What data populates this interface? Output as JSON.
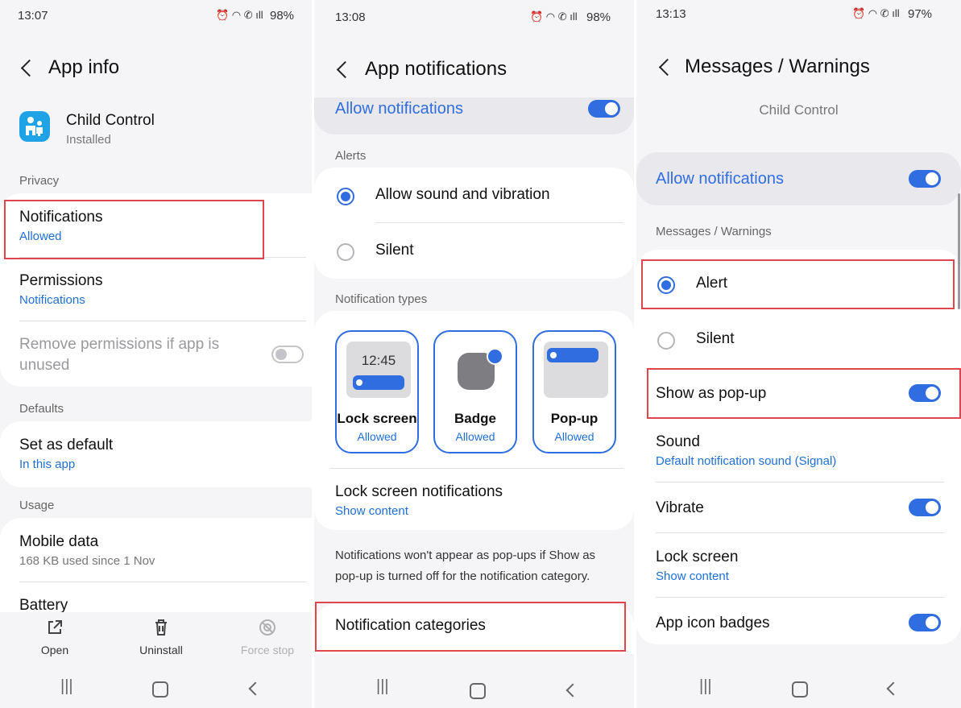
{
  "status": {
    "p1": {
      "time": "13:07",
      "battery": "98%"
    },
    "p2": {
      "time": "13:08",
      "battery": "98%"
    },
    "p3": {
      "time": "13:13",
      "battery": "97%"
    }
  },
  "panel1": {
    "title": "App info",
    "app_name": "Child Control",
    "app_status": "Installed",
    "section_privacy": "Privacy",
    "notifications": {
      "label": "Notifications",
      "value": "Allowed"
    },
    "permissions": {
      "label": "Permissions",
      "value": "Notifications"
    },
    "remove_permissions": {
      "label_line1": "Remove permissions if app is",
      "label_line2": "unused",
      "enabled": false
    },
    "section_defaults": "Defaults",
    "set_default": {
      "label": "Set as default",
      "value": "In this app"
    },
    "section_usage": "Usage",
    "mobile_data": {
      "label": "Mobile data",
      "value": "168 KB used since 1 Nov"
    },
    "battery": {
      "label": "Battery"
    },
    "bottom_actions": {
      "open": "Open",
      "uninstall": "Uninstall",
      "force_stop": "Force stop"
    }
  },
  "panel2": {
    "title": "App notifications",
    "allow_notifications": {
      "label": "Allow notifications",
      "enabled": true
    },
    "section_alerts": "Alerts",
    "alert_options": [
      {
        "label": "Allow sound and vibration",
        "selected": true
      },
      {
        "label": "Silent",
        "selected": false
      }
    ],
    "section_types": "Notification types",
    "types": [
      {
        "label": "Lock screen",
        "value": "Allowed",
        "preview_time": "12:45"
      },
      {
        "label": "Badge",
        "value": "Allowed"
      },
      {
        "label": "Pop-up",
        "value": "Allowed"
      }
    ],
    "lock_screen_notifications": {
      "label": "Lock screen notifications",
      "value": "Show content"
    },
    "info_line1": "Notifications won't appear as pop-ups if Show as",
    "info_line2": "pop-up is turned off for the notification category.",
    "categories": "Notification categories"
  },
  "panel3": {
    "title": "Messages / Warnings",
    "subtitle": "Child Control",
    "allow_notifications": {
      "label": "Allow notifications",
      "enabled": true
    },
    "section_category": "Messages / Warnings",
    "options": [
      {
        "label": "Alert",
        "selected": true
      },
      {
        "label": "Silent",
        "selected": false
      }
    ],
    "show_popup": {
      "label": "Show as pop-up",
      "enabled": true
    },
    "sound": {
      "label": "Sound",
      "value": "Default notification sound (Signal)"
    },
    "vibrate": {
      "label": "Vibrate",
      "enabled": true
    },
    "lock_screen": {
      "label": "Lock screen",
      "value": "Show content"
    },
    "app_icon_badges": {
      "label": "App icon badges",
      "enabled": true
    }
  },
  "colors": {
    "accent": "#2f6de0",
    "highlight": "#e0474c",
    "background": "#f5f5f7"
  }
}
